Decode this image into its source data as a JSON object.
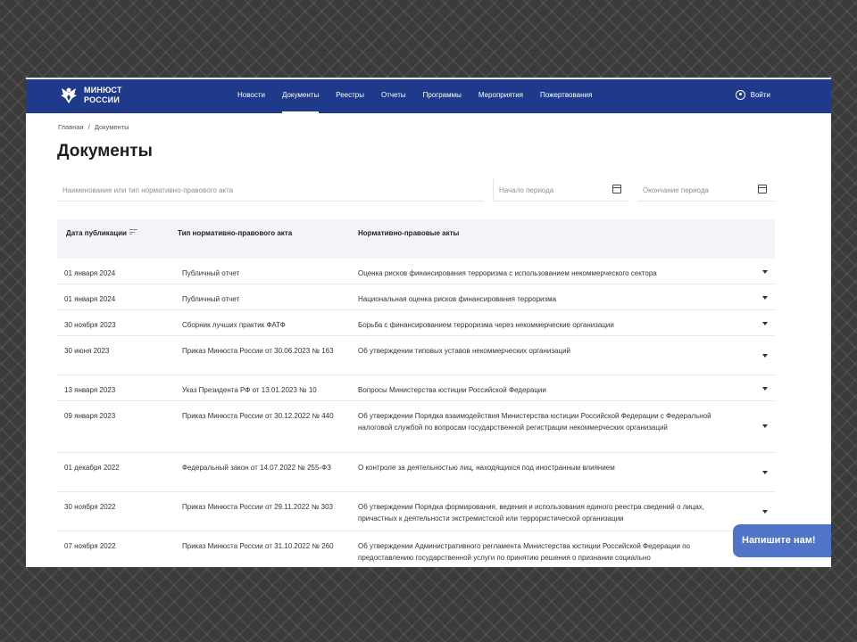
{
  "header": {
    "logo_line1": "МИНЮСТ",
    "logo_line2": "РОССИИ",
    "nav": [
      "Новости",
      "Документы",
      "Реестры",
      "Отчеты",
      "Программы",
      "Мероприятия",
      "Пожертвования"
    ],
    "active_nav": "Документы",
    "login_label": "Войти",
    "brand_color": "#1f3a8a"
  },
  "breadcrumb": [
    "Главная",
    "/",
    "Документы"
  ],
  "page_title": "Документы",
  "filters": {
    "search_placeholder": "Наименование или тип нормативно-правового акта",
    "start_placeholder": "Начало периода",
    "end_placeholder": "Окончание периода"
  },
  "table": {
    "headers": [
      "Дата публикации",
      "Тип нормативно-правового акта",
      "Нормативно-правовые акты"
    ],
    "rows": [
      {
        "date": "01 января 2024",
        "type": "Публичный отчет",
        "act": "Оценка рисков финансирования терроризма с использованием некоммерческого сектора"
      },
      {
        "date": "01 января 2024",
        "type": "Публичный отчет",
        "act": "Национальная оценка рисков финансирования терроризма"
      },
      {
        "date": "30 ноября 2023",
        "type": "Сборник лучших практик ФАТФ",
        "act": "Борьба с финансированием терроризма через некоммерческие организации"
      },
      {
        "date": "30 июня 2023",
        "type": "Приказ Минюста России от 30.06.2023 № 163",
        "act": "Об утверждении типовых уставов некоммерческих организаций"
      },
      {
        "date": "13 января 2023",
        "type": "Указ Президента РФ от 13.01.2023 № 10",
        "act": "Вопросы Министерства юстиции Российской Федерации"
      },
      {
        "date": "09 января 2023",
        "type": "Приказ Минюста России от 30.12.2022 № 440",
        "act": "Об утверждении Порядка взаимодействия Министерства юстиции Российской Федерации с Федеральной налоговой службой по вопросам государственной регистрации некоммерческих организаций"
      },
      {
        "date": "01 декабря 2022",
        "type": "Федеральный закон от 14.07.2022 № 255-ФЗ",
        "act": "О контроле за деятельностью лиц, находящихся под иностранным влиянием"
      },
      {
        "date": "30 ноября 2022",
        "type": "Приказ Минюста России от 29.11.2022 № 303",
        "act": "Об утверждении Порядка формирования, ведения и использования единого реестра сведений о лицах, причастных к деятельности экстремистской или террористической организации"
      },
      {
        "date": "07 ноября 2022",
        "type": "Приказ Минюста России от 31.10.2022 № 260",
        "act": "Об утверждении Административного регламента Министерства юстиции Российской Федерации по предоставлению государственной услуги по принятию решения о признании социально"
      }
    ]
  },
  "chat_button": "Напишите нам!"
}
